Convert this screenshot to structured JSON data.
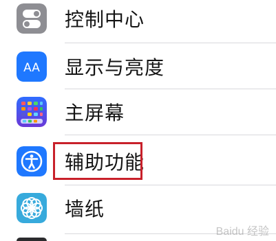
{
  "settings": {
    "items": [
      {
        "label": "控制中心",
        "icon": "control-center-icon",
        "color": "#8e8e93"
      },
      {
        "label": "显示与亮度",
        "icon": "display-brightness-icon",
        "color": "#1f78ff"
      },
      {
        "label": "主屏幕",
        "icon": "home-screen-icon",
        "color": "#1f78ff"
      },
      {
        "label": "辅助功能",
        "icon": "accessibility-icon",
        "color": "#1f78ff"
      },
      {
        "label": "墙纸",
        "icon": "wallpaper-icon",
        "color": "#37aadc"
      }
    ]
  },
  "annotation": {
    "highlight_color": "#c8202a"
  },
  "watermark": {
    "text": "Baidu 经验"
  }
}
